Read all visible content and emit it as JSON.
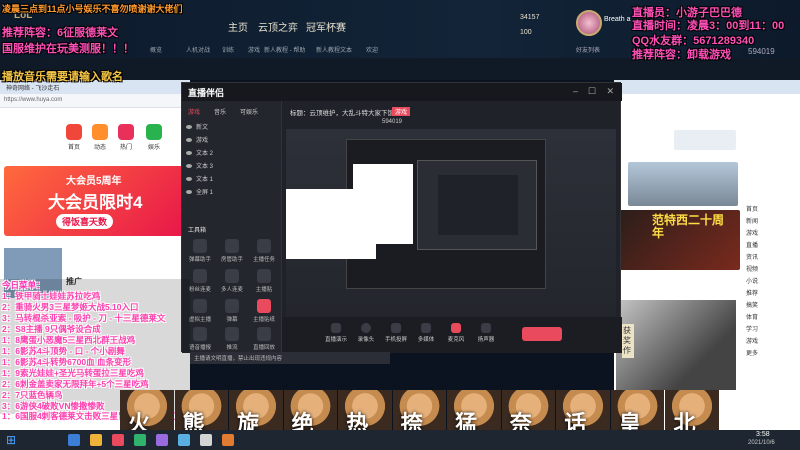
{
  "overlays": {
    "top_left": "凌晨三点到11点小号娱乐不喜勿喷谢谢大佬们",
    "recommend": "推荐阵容：6征服德莱文",
    "national": "国服维护在玩美测服！！！",
    "music": "播放音乐需要请输入歌名",
    "streamer": "直播员：小游子巴巴德",
    "time": "直播时间：凌晨3：00到11：00",
    "qq": "QQ水友群：5671289340",
    "lineup": "推荐阵容：卸载游戏",
    "room_id": "594019"
  },
  "game_header": {
    "logo": "LoL",
    "nav": [
      "主页",
      "云顶之弈",
      "冠军杯赛"
    ],
    "subnav": [
      "概览",
      "人机对战",
      "训练",
      "游戏",
      "新人教程 - 帮助",
      "新人教程文本",
      "欢迎"
    ],
    "gold": "34157",
    "rp": "100",
    "friends_label": "好友列表",
    "player": "Breath a"
  },
  "left_browser": {
    "tab": "神奇网络 - 飞沙走石",
    "address": "https://www.huya.com",
    "shortcuts": [
      "首页",
      "动态",
      "热门",
      "娱乐"
    ],
    "banner_top": "大会员5周年",
    "banner_main": "大会员限时4",
    "banner_sub": "得饭喜天数",
    "list_title": "推广"
  },
  "main_window": {
    "title": "直播伴侣",
    "tabs": [
      "游戏",
      "音乐",
      "可娱乐"
    ],
    "sources": [
      "新文",
      "游戏",
      "文本 2",
      "文本 3",
      "文本 1",
      "全屏 1"
    ],
    "tools_label": "工具箱",
    "tools": [
      "弹幕助手",
      "房管助手",
      "主播任务",
      "粉丝连麦",
      "多人连麦",
      "主播贴",
      "虚拟主播",
      "弹幕",
      "主播贴纸",
      "语音播报",
      "推流",
      "直播回放"
    ],
    "stream_title": "标题：云顶维护，大乱斗特大家下饭",
    "stream_tag": "游戏",
    "room_line": "594019",
    "bottom": [
      "直播演示",
      "录像头",
      "手机投屏",
      "多媒体",
      "麦克风",
      "扬声器"
    ],
    "danmu": "主播请文明直播，禁止出现违规内容"
  },
  "menu": {
    "title": "今日菜单：",
    "items": [
      "1：铁甲骑士娃娃苏拉吃鸡",
      "2：重骑火男3三星梦姬大战5.10入口",
      "3：马转棍杀亚索 - 吸护 - 刀 - 十三星德莱文",
      "2：S8主播 9只偶爷设合成",
      "1：8鹰蛋小恶魔5三星西北群王战鸡",
      "1：6影苏4斗顶势 - 口 - 个小剧舞",
      "1：6影苏4斗转势6700血 血条变形",
      "1：9索光娃娃+圣光马转蛋拉三星吃鸡",
      "2：6刺金盖卖家无限拜年+5个三星吃鸡",
      "2：7只蓝色辆鸟",
      "3：6游侠4破败VN惨撒惨败",
      "1：6国服4刺客德莱文击败三星冒险撑健康吊刀"
    ]
  },
  "dog_strip": [
    "火",
    "熊",
    "旋",
    "绝",
    "热",
    "捺",
    "猛",
    "奈",
    "话",
    "皇",
    "北"
  ],
  "right_browser": {
    "banner": "范特西二十周年",
    "badge": "获奖作",
    "nav": [
      "首页",
      "新闻",
      "游戏",
      "直播",
      "资讯",
      "视频",
      "小说",
      "推荐",
      "搞笑",
      "体育",
      "学习",
      "游戏",
      "更多"
    ]
  },
  "taskbar": {
    "time": "3:58",
    "date": "2021/10/6"
  }
}
